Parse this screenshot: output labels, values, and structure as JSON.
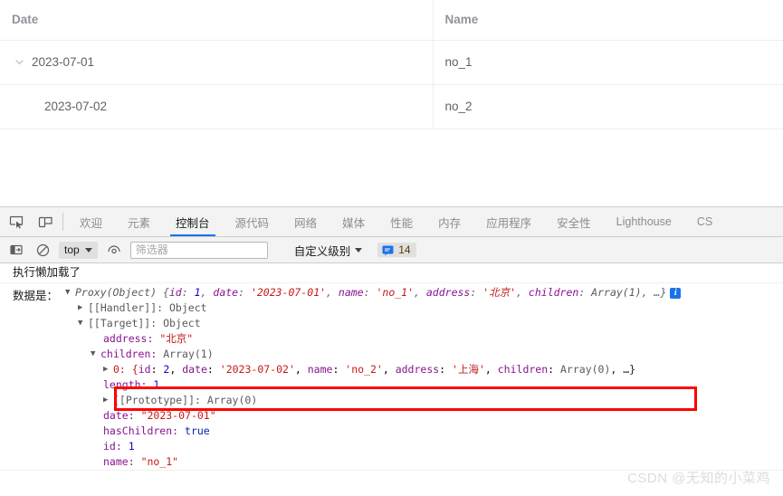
{
  "table": {
    "columns": [
      {
        "key": "date",
        "label": "Date"
      },
      {
        "key": "name",
        "label": "Name"
      }
    ],
    "rows": [
      {
        "date": "2023-07-01",
        "name": "no_1",
        "expandable": true,
        "expanded": true,
        "level": 0
      },
      {
        "date": "2023-07-02",
        "name": "no_2",
        "expandable": false,
        "expanded": false,
        "level": 1
      }
    ]
  },
  "devtools": {
    "tabs": [
      {
        "label": "欢迎",
        "active": false
      },
      {
        "label": "元素",
        "active": false
      },
      {
        "label": "控制台",
        "active": true
      },
      {
        "label": "源代码",
        "active": false
      },
      {
        "label": "网络",
        "active": false
      },
      {
        "label": "媒体",
        "active": false
      },
      {
        "label": "性能",
        "active": false
      },
      {
        "label": "内存",
        "active": false
      },
      {
        "label": "应用程序",
        "active": false
      },
      {
        "label": "安全性",
        "active": false
      },
      {
        "label": "Lighthouse",
        "active": false
      },
      {
        "label": "CS",
        "active": false
      }
    ],
    "tool_icons": [
      {
        "name": "inspect-element-icon"
      },
      {
        "name": "device-toolbar-icon"
      }
    ],
    "console_toolbar": {
      "sidebar_toggle_icon": "console-sidebar-icon",
      "clear_icon": "clear-console-icon",
      "context_value": "top",
      "eye_icon": "live-expression-icon",
      "filter_placeholder": "筛选器",
      "filter_value": "",
      "level_label": "自定义级别",
      "issues_count": "14",
      "issues_icon": "message-issues-icon"
    },
    "console": {
      "line1": "执行懒加载了",
      "line2_label": "数据是：",
      "preview": {
        "ctor": "Proxy(Object)",
        "open": " {",
        "k_id": "id",
        "v_id": "1",
        "k_date": "date",
        "v_date": "'2023-07-01'",
        "k_name": "name",
        "v_name": "'no_1'",
        "k_address": "address",
        "v_address": "'北京'",
        "k_children": "children",
        "v_children": "Array(1)",
        "ellipsis": ", …}",
        "info_badge": "i"
      },
      "nodes": {
        "handler": "[[Handler]]: Object",
        "target": "[[Target]]: Object",
        "address_key": "address:",
        "address_val": "\"北京\"",
        "children_key": "children:",
        "children_val": "Array(1)",
        "child0": {
          "index": "0: {",
          "k_id": "id",
          "v_id": "2",
          "k_date": "date",
          "v_date": "'2023-07-02'",
          "k_name": "name",
          "v_name": "'no_2'",
          "k_address": "address",
          "v_address": "'上海'",
          "k_children": "children",
          "v_children": "Array(0)",
          "ellipsis": ", …}"
        },
        "length_key": "length:",
        "length_val": "1",
        "proto_array": "[[Prototype]]: Array(0)",
        "date_key": "date:",
        "date_val": "\"2023-07-01\"",
        "haschildren_key": "hasChildren:",
        "haschildren_val": "true",
        "id_key": "id:",
        "id_val": "1",
        "name_key": "name:",
        "name_val": "\"no_1\""
      }
    }
  },
  "annotation": {
    "highlight_color": "#ff0000"
  },
  "watermark": {
    "text": "CSDN @无知的小菜鸡"
  }
}
